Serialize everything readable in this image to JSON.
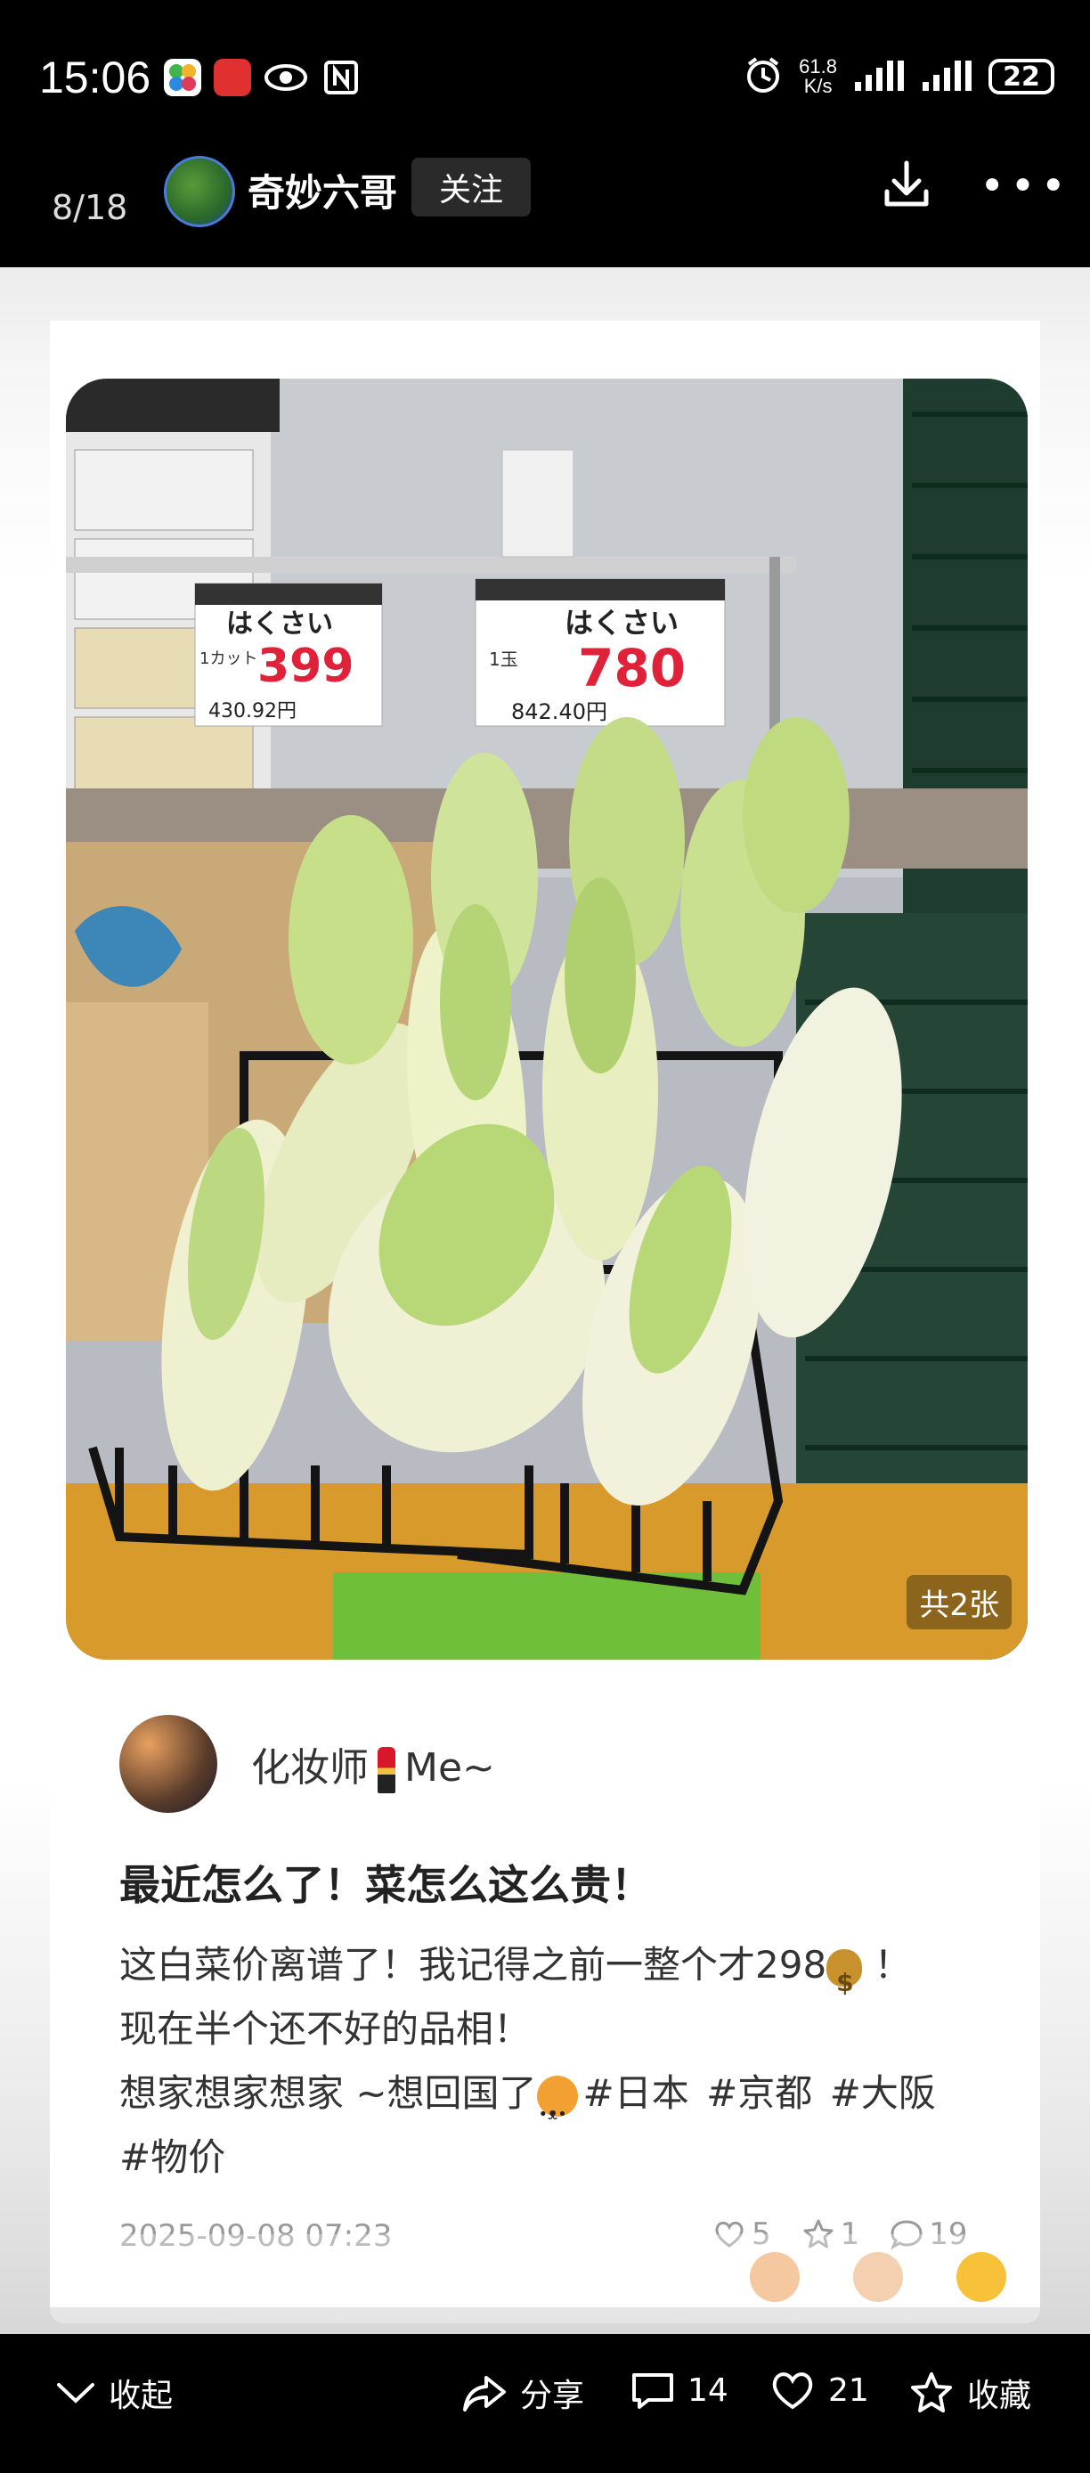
{
  "status_bar": {
    "time": "15:06",
    "network_speed_value": "61.8",
    "network_speed_unit": "K/s",
    "battery": "22"
  },
  "header": {
    "page_indicator": "8/18",
    "username": "奇妙六哥",
    "follow_label": "关注"
  },
  "photo": {
    "image_count": "共2张",
    "sign_left": {
      "title": "はくさい",
      "qty": "1カット",
      "price": "399",
      "tax_incl": "430.92円"
    },
    "sign_right": {
      "title": "はくさい",
      "qty": "1玉",
      "price": "780",
      "tax_incl": "842.40円"
    }
  },
  "post": {
    "author": "化妆师",
    "author_suffix": "Me~",
    "title": "最近怎么了！菜怎么这么贵！",
    "line1_a": "这白菜价离谱了！我记得之前一整个才298",
    "line1_b": "！",
    "line2": "现在半个还不好的品相！",
    "line3_a": "想家想家想家 ~想回国了",
    "tags": [
      "#日本",
      "#京都",
      "#大阪",
      "#物价"
    ],
    "timestamp": "2025-09-08 07:23",
    "likes": "5",
    "favorites": "1",
    "comments": "19"
  },
  "bottom_bar": {
    "collapse_label": "收起",
    "share_label": "分享",
    "comment_count": "14",
    "like_count": "21",
    "favorite_label": "收藏"
  },
  "colors": {
    "background": "#000000",
    "price_red": "#e0213a",
    "accent": "#ffffff"
  }
}
